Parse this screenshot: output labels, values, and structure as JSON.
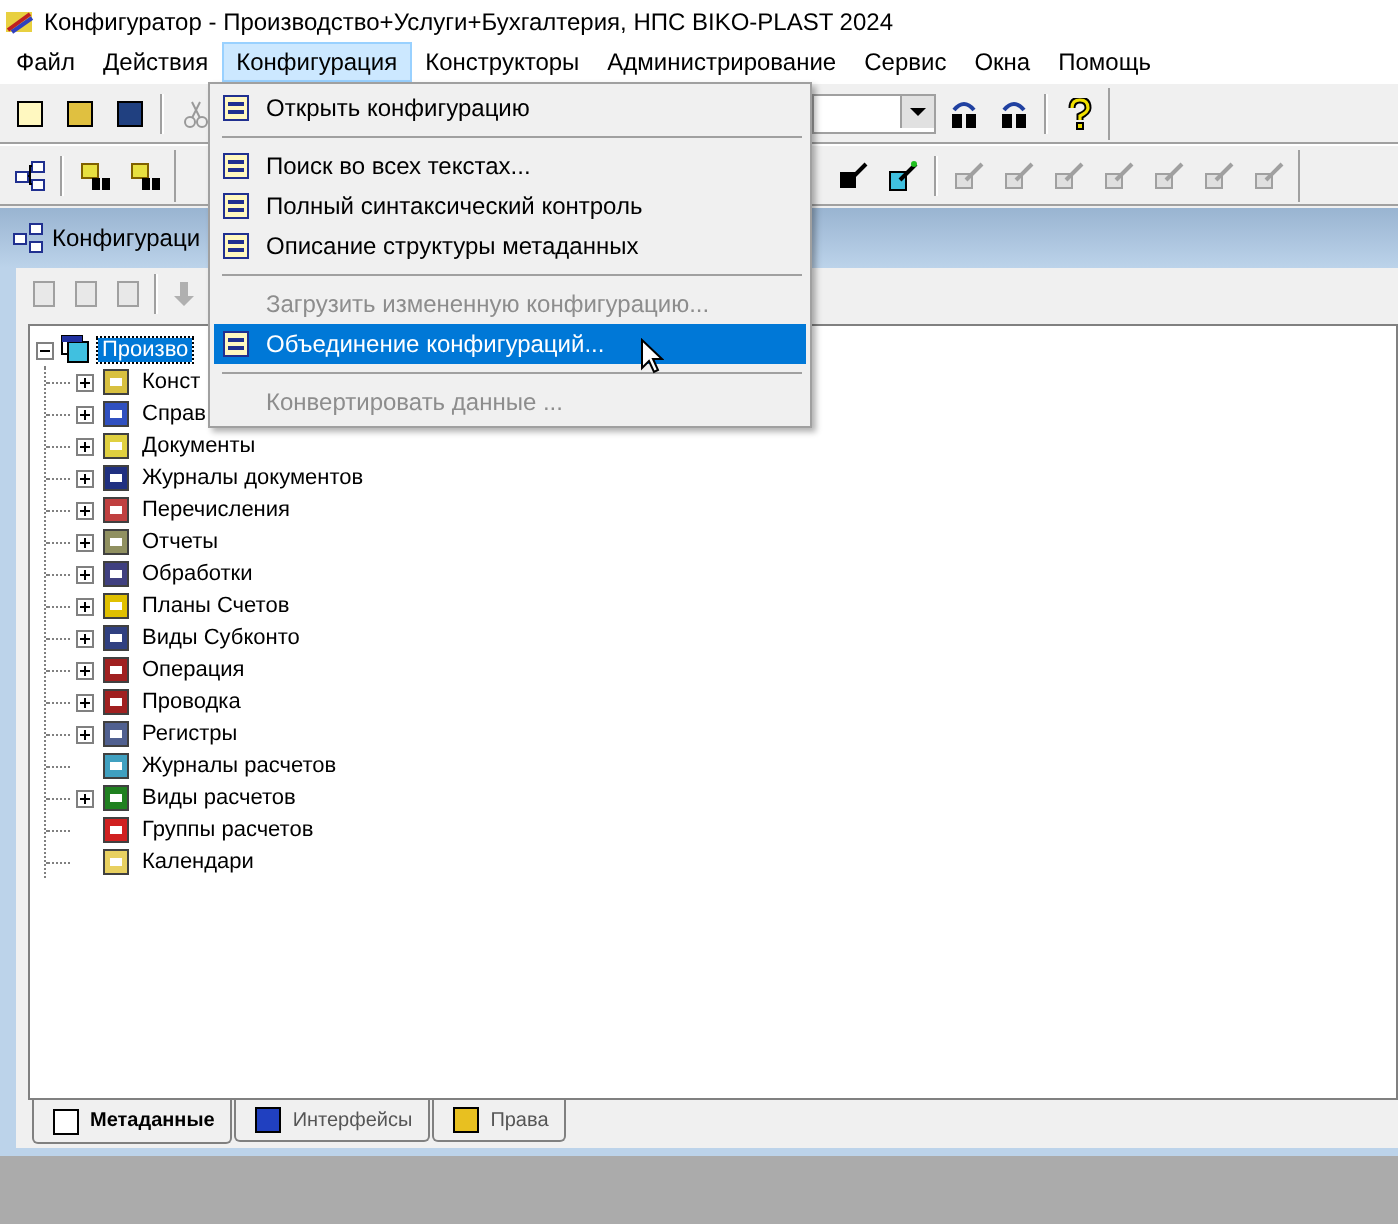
{
  "window": {
    "title": "Конфигуратор - Производство+Услуги+Бухгалтерия, НПС BIKO-PLAST 2024"
  },
  "menu_bar": [
    {
      "label": "Файл",
      "selected": false
    },
    {
      "label": "Действия",
      "selected": false
    },
    {
      "label": "Конфигурация",
      "selected": true
    },
    {
      "label": "Конструкторы",
      "selected": false
    },
    {
      "label": "Администрирование",
      "selected": false
    },
    {
      "label": "Сервис",
      "selected": false
    },
    {
      "label": "Окна",
      "selected": false
    },
    {
      "label": "Помощь",
      "selected": false
    }
  ],
  "dropdown_menu": [
    {
      "kind": "item",
      "label": "Открыть конфигурацию",
      "disabled": false,
      "selected": false
    },
    {
      "kind": "separator"
    },
    {
      "kind": "item",
      "label": "Поиск во всех текстах...",
      "disabled": false,
      "selected": false
    },
    {
      "kind": "item",
      "label": "Полный синтаксический контроль",
      "disabled": false,
      "selected": false
    },
    {
      "kind": "item",
      "label": "Описание структуры метаданных",
      "disabled": false,
      "selected": false
    },
    {
      "kind": "separator"
    },
    {
      "kind": "item",
      "label": "Загрузить измененную конфигурацию...",
      "disabled": true,
      "selected": false
    },
    {
      "kind": "item",
      "label": "Объединение конфигураций...",
      "disabled": false,
      "selected": true
    },
    {
      "kind": "separator"
    },
    {
      "kind": "item",
      "label": "Конвертировать данные ...",
      "disabled": true,
      "selected": false
    }
  ],
  "child_window": {
    "title": "Конфигураци"
  },
  "tree": [
    {
      "label": "Произво",
      "selected": true,
      "expanded": true,
      "children": [
        {
          "label": "Конст",
          "expandable": true
        },
        {
          "label": "Справ",
          "expandable": true
        },
        {
          "label": "Документы",
          "expandable": true
        },
        {
          "label": "Журналы документов",
          "expandable": true
        },
        {
          "label": "Перечисления",
          "expandable": true
        },
        {
          "label": "Отчеты",
          "expandable": true
        },
        {
          "label": "Обработки",
          "expandable": true
        },
        {
          "label": "Планы Счетов",
          "expandable": true
        },
        {
          "label": "Виды Субконто",
          "expandable": true
        },
        {
          "label": "Операция",
          "expandable": true
        },
        {
          "label": "Проводка",
          "expandable": true
        },
        {
          "label": "Регистры",
          "expandable": true
        },
        {
          "label": "Журналы расчетов",
          "expandable": false
        },
        {
          "label": "Виды расчетов",
          "expandable": true
        },
        {
          "label": "Группы расчетов",
          "expandable": false
        },
        {
          "label": "Календари",
          "expandable": false
        }
      ]
    }
  ],
  "bottom_tabs": [
    {
      "label": "Метаданные",
      "selected": true
    },
    {
      "label": "Интерфейсы",
      "selected": false
    },
    {
      "label": "Права",
      "selected": false
    }
  ]
}
